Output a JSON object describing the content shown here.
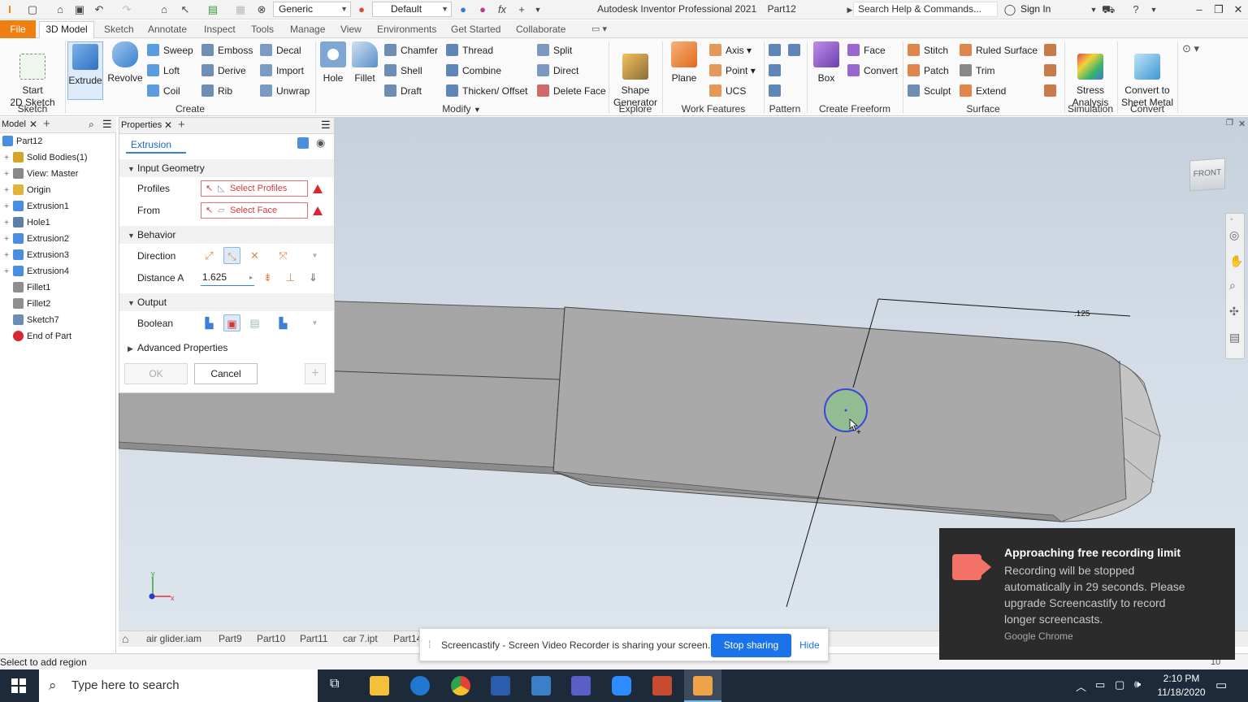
{
  "window": {
    "app_title": "Autodesk Inventor Professional 2021",
    "doc_title": "Part12",
    "search_placeholder": "Search Help & Commands...",
    "sign_in": "Sign In",
    "material": "Generic",
    "appearance": "Default"
  },
  "ribbon_tabs": [
    "File",
    "3D Model",
    "Sketch",
    "Annotate",
    "Inspect",
    "Tools",
    "Manage",
    "View",
    "Environments",
    "Get Started",
    "Collaborate"
  ],
  "ribbon": {
    "start_sketch": "Start\n2D Sketch",
    "sketch_group": "Sketch",
    "extrude": "Extrude",
    "revolve": "Revolve",
    "sweep": "Sweep",
    "loft": "Loft",
    "coil": "Coil",
    "emboss": "Emboss",
    "derive": "Derive",
    "rib": "Rib",
    "decal": "Decal",
    "import": "Import",
    "unwrap": "Unwrap",
    "create_group": "Create",
    "hole": "Hole",
    "fillet": "Fillet",
    "chamfer": "Chamfer",
    "shell": "Shell",
    "draft": "Draft",
    "thread": "Thread",
    "combine": "Combine",
    "thicken": "Thicken/ Offset",
    "split": "Split",
    "direct": "Direct",
    "delete_face": "Delete Face",
    "modify_group": "Modify",
    "shape_generator": "Shape\nGenerator",
    "explore_group": "Explore",
    "plane": "Plane",
    "axis": "Axis",
    "point": "Point",
    "ucs": "UCS",
    "work_features_group": "Work Features",
    "pattern_group": "Pattern",
    "box": "Box",
    "face": "Face",
    "convert": "Convert",
    "create_freeform_group": "Create Freeform",
    "stitch": "Stitch",
    "patch": "Patch",
    "sculpt": "Sculpt",
    "ruled_surface": "Ruled Surface",
    "trim": "Trim",
    "extend": "Extend",
    "surface_group": "Surface",
    "stress": "Stress\nAnalysis",
    "simulation_group": "Simulation",
    "convert_sheet": "Convert to\nSheet Metal",
    "convert_group": "Convert"
  },
  "browser": {
    "tab": "Model",
    "items": [
      {
        "label": "Part12",
        "level": 0
      },
      {
        "label": "Solid Bodies(1)",
        "level": 1
      },
      {
        "label": "View: Master",
        "level": 1
      },
      {
        "label": "Origin",
        "level": 1
      },
      {
        "label": "Extrusion1",
        "level": 1
      },
      {
        "label": "Hole1",
        "level": 1
      },
      {
        "label": "Extrusion2",
        "level": 1
      },
      {
        "label": "Extrusion3",
        "level": 1
      },
      {
        "label": "Extrusion4",
        "level": 1
      },
      {
        "label": "Fillet1",
        "level": 1
      },
      {
        "label": "Fillet2",
        "level": 1
      },
      {
        "label": "Sketch7",
        "level": 1
      },
      {
        "label": "End of Part",
        "level": 1
      }
    ]
  },
  "properties": {
    "tab": "Properties",
    "feature": "Extrusion",
    "input_geometry": "Input Geometry",
    "profiles_label": "Profiles",
    "profiles_value": "Select Profiles",
    "from_label": "From",
    "from_value": "Select Face",
    "behavior": "Behavior",
    "direction_label": "Direction",
    "distance_label": "Distance A",
    "distance_value": "1.625",
    "output": "Output",
    "boolean_label": "Boolean",
    "advanced": "Advanced Properties",
    "ok": "OK",
    "cancel": "Cancel"
  },
  "viewport": {
    "viewcube": "FRONT",
    "dimension": ".125"
  },
  "doc_tabs": [
    "air glider.iam",
    "Part9",
    "Part10",
    "Part11",
    "car 7.ipt",
    "Part14"
  ],
  "status_text": "Select to add region",
  "share_bar": {
    "message": "Screencastify - Screen Video Recorder is sharing your screen.",
    "stop": "Stop sharing",
    "hide": "Hide"
  },
  "toast": {
    "title": "Approaching free recording limit",
    "body": "Recording will be stopped automatically in 29 seconds. Please upgrade Screencastify to record longer screencasts.",
    "source": "Google Chrome"
  },
  "taskbar": {
    "search": "Type here to search",
    "time": "2:10 PM",
    "date": "11/18/2020"
  },
  "colors": {
    "file_tab": "#f07f12",
    "accent_blue": "#1a73e8",
    "warning_red": "#d9282f"
  }
}
